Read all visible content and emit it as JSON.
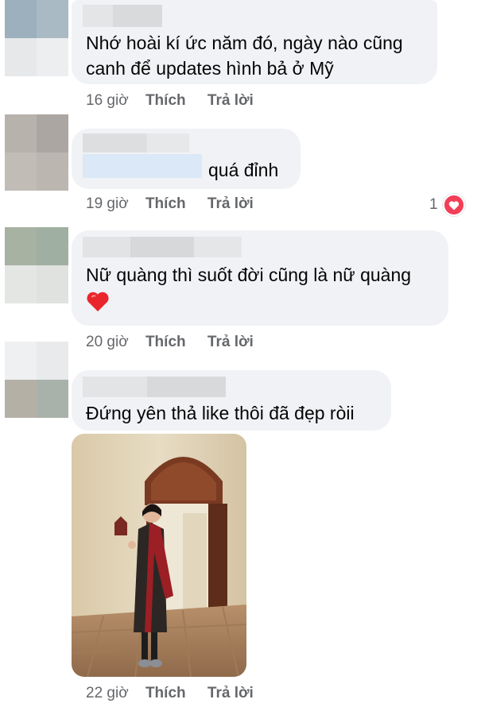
{
  "comments": [
    {
      "text_lines": [
        "Nhớ hoài kí ức năm đó, ngày nào cũng",
        "canh để updates hình bả ở Mỹ"
      ],
      "time": "16 giờ",
      "like_label": "Thích",
      "reply_label": "Trả lời"
    },
    {
      "text": "quá đỉnh",
      "time": "19 giờ",
      "like_label": "Thích",
      "reply_label": "Trả lời",
      "reaction_count": "1"
    },
    {
      "text": "Nữ quàng thì suốt đời cũng là nữ quàng",
      "emoji": "❤️",
      "time": "20 giờ",
      "like_label": "Thích",
      "reply_label": "Trả lời"
    },
    {
      "text": "Đứng yên thả like thôi đã đẹp ròii",
      "time": "22 giờ",
      "like_label": "Thích",
      "reply_label": "Trả lời"
    }
  ],
  "colors": {
    "bubble": "#f0f2f5",
    "meta_text": "#65676b",
    "love_reaction": "#f33e58"
  }
}
